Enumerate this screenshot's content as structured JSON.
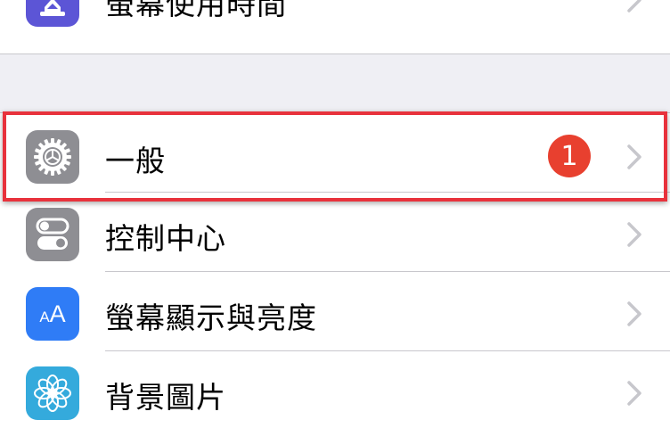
{
  "rows": {
    "screen_time": {
      "label": "螢幕使用時間",
      "icon": "hourglass-icon",
      "icon_color": "#5c55d6"
    },
    "general": {
      "label": "一般",
      "icon": "gear-icon",
      "icon_color": "#8e8e93",
      "badge": "1",
      "badge_color": "#e8402f"
    },
    "control_center": {
      "label": "控制中心",
      "icon": "toggles-icon",
      "icon_color": "#8e8e93"
    },
    "display_brightness": {
      "label": "螢幕顯示與亮度",
      "icon": "text-size-icon",
      "icon_glyph": "AA",
      "icon_color": "#2f7cf6"
    },
    "wallpaper": {
      "label": "背景圖片",
      "icon": "flower-icon",
      "icon_color": "#34aadc"
    }
  },
  "highlight_color": "#e8323c"
}
